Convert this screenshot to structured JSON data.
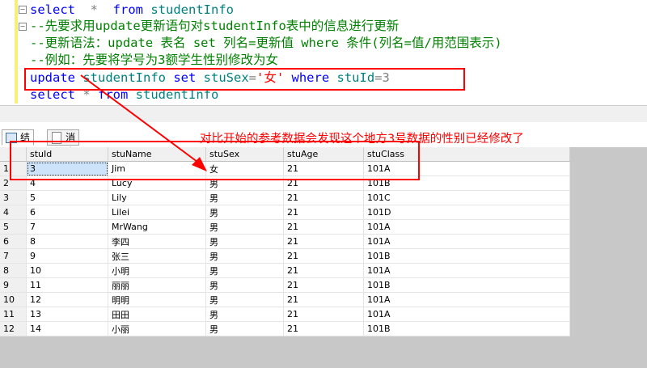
{
  "editor": {
    "lines": [
      {
        "tokens": [
          {
            "t": "select",
            "c": "kw"
          },
          {
            "t": "  *  ",
            "c": "gy"
          },
          {
            "t": "from",
            "c": "kw"
          },
          {
            "t": " studentInfo",
            "c": "id"
          }
        ]
      },
      {
        "tokens": [
          {
            "t": "--先要求用update更新语句对studentInfo表中的信息进行更新",
            "c": "cm"
          }
        ]
      },
      {
        "tokens": [
          {
            "t": "--更新语法：update 表名 set 列名=更新值 where 条件(列名=值/用范围表示)",
            "c": "cm"
          }
        ]
      },
      {
        "tokens": [
          {
            "t": "--例如：先要将学号为3额学生性别修改为女",
            "c": "cm"
          }
        ]
      },
      {
        "tokens": [
          {
            "t": "update",
            "c": "kw"
          },
          {
            "t": " studentInfo ",
            "c": "id"
          },
          {
            "t": "set",
            "c": "kw"
          },
          {
            "t": " stuSex",
            "c": "id"
          },
          {
            "t": "=",
            "c": "gy"
          },
          {
            "t": "'女'",
            "c": "str"
          },
          {
            "t": " where",
            "c": "kw"
          },
          {
            "t": " stuId",
            "c": "id"
          },
          {
            "t": "=3",
            "c": "gy"
          }
        ]
      },
      {
        "tokens": [
          {
            "t": "select",
            "c": "kw"
          },
          {
            "t": " * ",
            "c": "gy"
          },
          {
            "t": "from",
            "c": "kw"
          },
          {
            "t": " studentInfo",
            "c": "id"
          }
        ]
      }
    ]
  },
  "tabs": {
    "results": "结果",
    "messages": "消息"
  },
  "annotation": "对比开始的参考数据会发现这个地方3号数据的性别已经修改了",
  "grid": {
    "columns": [
      "stuId",
      "stuName",
      "stuSex",
      "stuAge",
      "stuClass"
    ],
    "rows": [
      [
        "1",
        "3",
        "Jim",
        "女",
        "21",
        "101A"
      ],
      [
        "2",
        "4",
        "Lucy",
        "男",
        "21",
        "101B"
      ],
      [
        "3",
        "5",
        "Lily",
        "男",
        "21",
        "101C"
      ],
      [
        "4",
        "6",
        "Lilei",
        "男",
        "21",
        "101D"
      ],
      [
        "5",
        "7",
        "MrWang",
        "男",
        "21",
        "101A"
      ],
      [
        "6",
        "8",
        "李四",
        "男",
        "21",
        "101A"
      ],
      [
        "7",
        "9",
        "张三",
        "男",
        "21",
        "101B"
      ],
      [
        "8",
        "10",
        "小明",
        "男",
        "21",
        "101A"
      ],
      [
        "9",
        "11",
        "丽丽",
        "男",
        "21",
        "101B"
      ],
      [
        "10",
        "12",
        "明明",
        "男",
        "21",
        "101A"
      ],
      [
        "11",
        "13",
        "田田",
        "男",
        "21",
        "101A"
      ],
      [
        "12",
        "14",
        "小丽",
        "男",
        "21",
        "101B"
      ]
    ]
  },
  "colors": {
    "annotation": "#ff0000",
    "keyword": "#0000ff",
    "comment": "#008000",
    "selected_cell": "#cde3fa"
  }
}
